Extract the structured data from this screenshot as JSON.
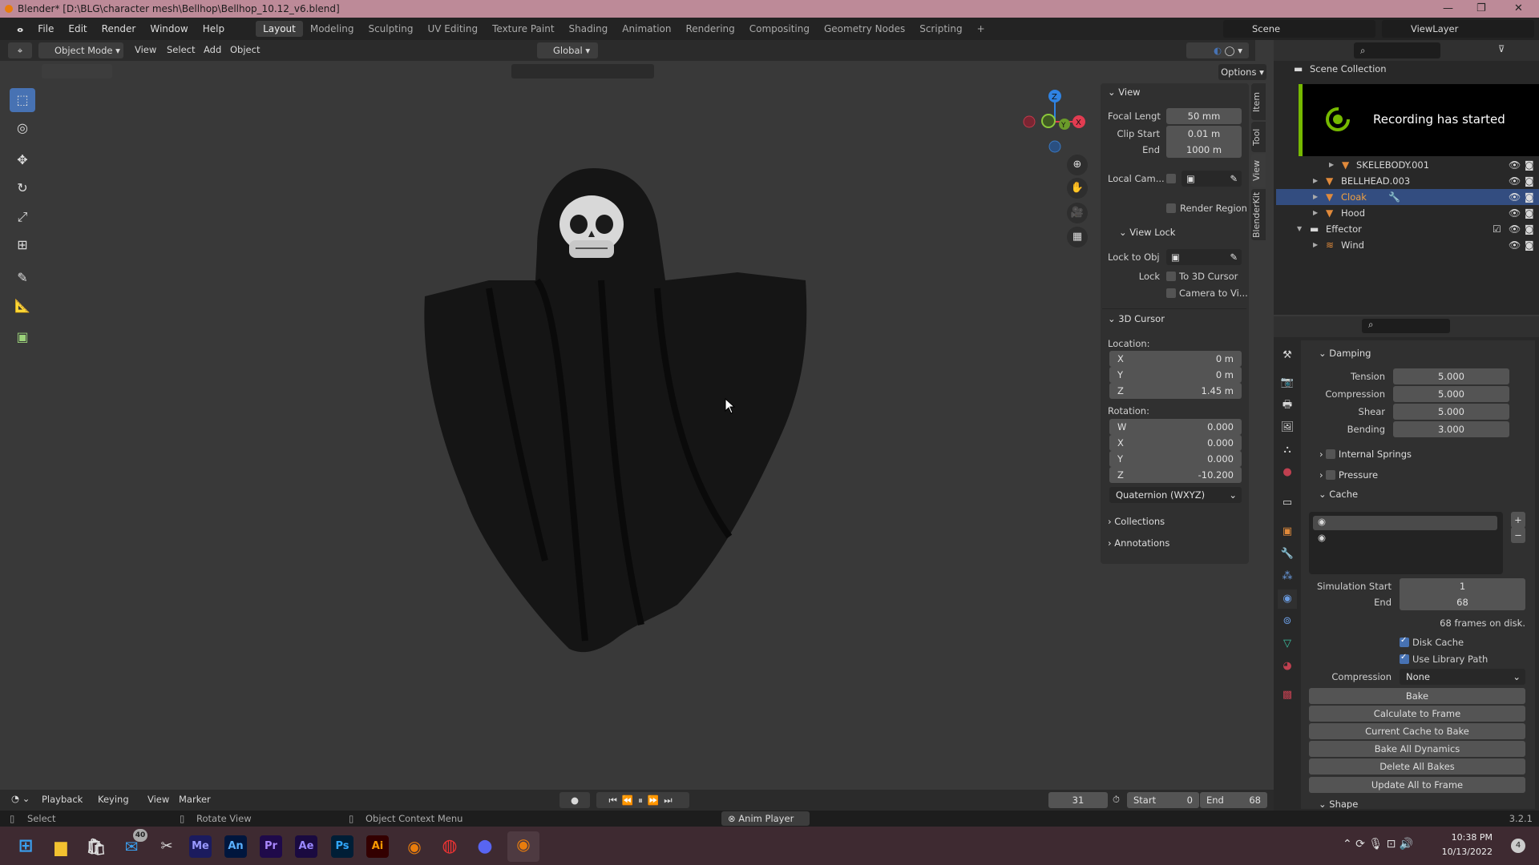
{
  "window": {
    "title": "Blender* [D:\\BLG\\character mesh\\Bellhop\\Bellhop_10.12_v6.blend]"
  },
  "menu": [
    "File",
    "Edit",
    "Render",
    "Window",
    "Help"
  ],
  "workspaces": [
    "Layout",
    "Modeling",
    "Sculpting",
    "UV Editing",
    "Texture Paint",
    "Shading",
    "Animation",
    "Rendering",
    "Compositing",
    "Geometry Nodes",
    "Scripting",
    "+"
  ],
  "active_workspace": "Layout",
  "scene": {
    "name": "Scene",
    "view_layer": "ViewLayer"
  },
  "viewport_header": {
    "mode": "Object Mode",
    "menus": [
      "View",
      "Select",
      "Add",
      "Object"
    ],
    "orientation": "Global",
    "options": "Options"
  },
  "toolbar": [
    "select-box",
    "cursor",
    "move",
    "rotate",
    "scale",
    "transform",
    "annotate",
    "measure",
    "add-cube"
  ],
  "sidebar_tabs": [
    "Item",
    "Tool",
    "View",
    "BlenderKit"
  ],
  "active_sidebar_tab": "View",
  "npanel": {
    "view": {
      "title": "View",
      "focal_label": "Focal Lengt",
      "focal": "50 mm",
      "clip_start_label": "Clip Start",
      "clip_start": "0.01 m",
      "end_label": "End",
      "end": "1000 m",
      "local_cam_label": "Local Cam...",
      "render_region": "Render Region"
    },
    "view_lock": {
      "title": "View Lock",
      "lock_to_obj": "Lock to Obj",
      "lock": "Lock",
      "to_3d_cursor": "To 3D Cursor",
      "camera_to_view": "Camera to Vi..."
    },
    "cursor": {
      "title": "3D Cursor",
      "location": "Location:",
      "loc": [
        {
          "axis": "X",
          "value": "0 m"
        },
        {
          "axis": "Y",
          "value": "0 m"
        },
        {
          "axis": "Z",
          "value": "1.45 m"
        }
      ],
      "rotation": "Rotation:",
      "rot": [
        {
          "axis": "W",
          "value": "0.000"
        },
        {
          "axis": "X",
          "value": "0.000"
        },
        {
          "axis": "Y",
          "value": "0.000"
        },
        {
          "axis": "Z",
          "value": "-10.200"
        }
      ],
      "mode": "Quaternion (WXYZ)"
    },
    "collections": "Collections",
    "annotations": "Annotations"
  },
  "outliner": {
    "root": "Scene Collection",
    "rows": [
      "SKELEBODY.001",
      "BELLHEAD.003",
      "Cloak",
      "Hood",
      "Effector",
      "Wind"
    ],
    "selected": "Cloak"
  },
  "toast": {
    "text": "Recording has started",
    "accent": "#76b900"
  },
  "properties": {
    "damping": {
      "title": "Damping",
      "fields": [
        {
          "label": "Tension",
          "value": "5.000"
        },
        {
          "label": "Compression",
          "value": "5.000"
        },
        {
          "label": "Shear",
          "value": "5.000"
        },
        {
          "label": "Bending",
          "value": "3.000"
        }
      ]
    },
    "internal_springs": "Internal Springs",
    "pressure": "Pressure",
    "cache": {
      "title": "Cache",
      "sim_start_label": "Simulation Start",
      "sim_start": "1",
      "end_label": "End",
      "end": "68",
      "frames_info": "68 frames on disk.",
      "disk_cache": "Disk Cache",
      "use_library_path": "Use Library Path",
      "compression_label": "Compression",
      "compression": "None",
      "buttons": [
        "Bake",
        "Calculate to Frame",
        "Current Cache to Bake",
        "Bake All Dynamics",
        "Delete All Bakes",
        "Update All to Frame"
      ]
    },
    "shape": "Shape"
  },
  "timeline": {
    "menus": [
      "Playback",
      "Keying",
      "View",
      "Marker"
    ],
    "current_frame": "31",
    "start_label": "Start",
    "start": "0",
    "end_label": "End",
    "end": "68"
  },
  "status": {
    "select": "Select",
    "rotate": "Rotate View",
    "context": "Object Context Menu",
    "anim_player": "Anim Player",
    "version": "3.2.1"
  },
  "taskbar": {
    "apps": [
      "Me",
      "An",
      "Pr",
      "Ae",
      "Ps",
      "Ai"
    ],
    "mail_badge": "40",
    "time": "10:38 PM",
    "date": "10/13/2022",
    "notif": "4"
  },
  "colors": {
    "accent": "#4772b3",
    "title_bar": "#bd8a98",
    "taskbar": "#3e2a31"
  }
}
